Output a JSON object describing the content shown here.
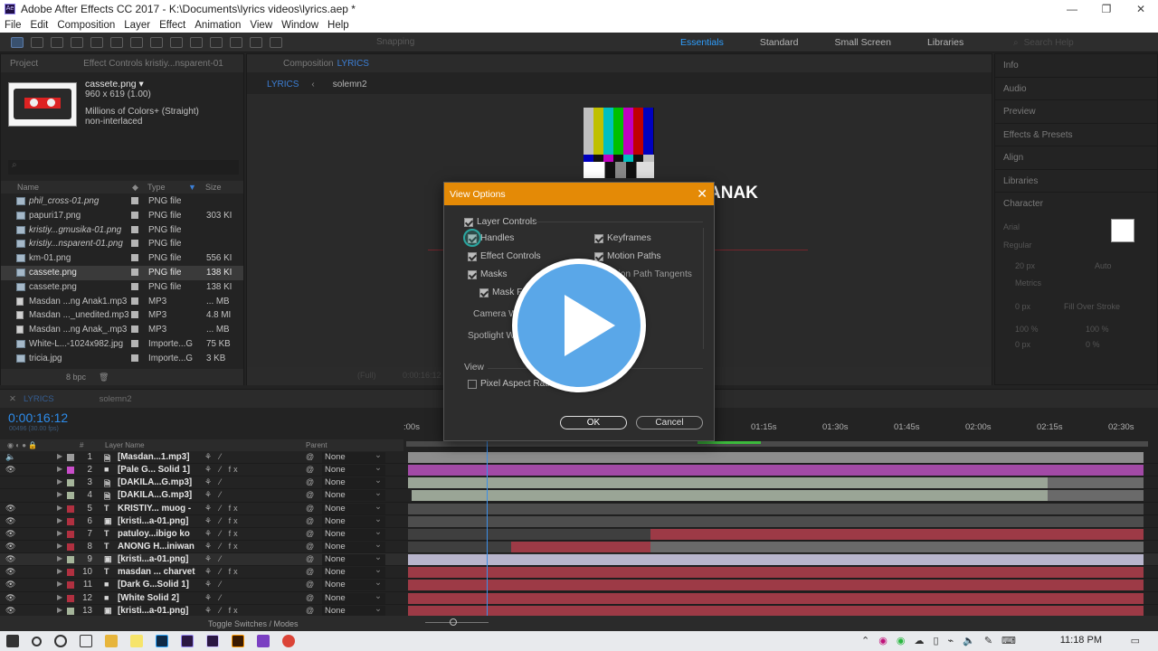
{
  "window": {
    "title": "Adobe After Effects CC 2017 - K:\\Documents\\lyrics videos\\lyrics.aep *",
    "minimize": "—",
    "maximize": "❐",
    "close": "✕"
  },
  "menu": [
    "File",
    "Edit",
    "Composition",
    "Layer",
    "Effect",
    "Animation",
    "View",
    "Window",
    "Help"
  ],
  "toolbar": {
    "snapping": "Snapping",
    "workspaces": [
      "Essentials",
      "Standard",
      "Small Screen",
      "Libraries"
    ],
    "active_workspace": "Essentials",
    "search_placeholder": "Search Help"
  },
  "project": {
    "tab_project": "Project",
    "tab_effect_controls": "Effect Controls kristiy...nsparent-01",
    "selected_file": {
      "name": "cassete.png",
      "dimensions": "960 x 619 (1.00)",
      "colors": "Millions of Colors+ (Straight)",
      "interlace": "non-interlaced"
    },
    "search_placeholder": "⌕",
    "columns": {
      "name": "Name",
      "type": "Type",
      "size": "Size"
    },
    "files": [
      {
        "name": "phil_cross-01.png",
        "type": "PNG file",
        "size": "",
        "italic": true,
        "kind": "image"
      },
      {
        "name": "papuri17.png",
        "type": "PNG file",
        "size": "303 KI",
        "italic": false,
        "kind": "image"
      },
      {
        "name": "kristiy...gmusika-01.png",
        "type": "PNG file",
        "size": "",
        "italic": true,
        "kind": "image"
      },
      {
        "name": "kristiy...nsparent-01.png",
        "type": "PNG file",
        "size": "",
        "italic": true,
        "kind": "image"
      },
      {
        "name": "km-01.png",
        "type": "PNG file",
        "size": "556 KI",
        "italic": false,
        "kind": "image"
      },
      {
        "name": "cassete.png",
        "type": "PNG file",
        "size": "138 KI",
        "italic": false,
        "kind": "image",
        "selected": true
      },
      {
        "name": "cassete.png",
        "type": "PNG file",
        "size": "138 KI",
        "italic": false,
        "kind": "image"
      },
      {
        "name": "Masdan ...ng Anak1.mp3",
        "type": "MP3",
        "size": "... MB",
        "italic": false,
        "kind": "audio"
      },
      {
        "name": "Masdan ..._unedited.mp3",
        "type": "MP3",
        "size": "4.8 MI",
        "italic": false,
        "kind": "audio"
      },
      {
        "name": "Masdan ...ng Anak_.mp3",
        "type": "MP3",
        "size": "... MB",
        "italic": false,
        "kind": "audio"
      },
      {
        "name": "White-L...-1024x982.jpg",
        "type": "Importe...G",
        "size": "75 KB",
        "italic": false,
        "kind": "image"
      },
      {
        "name": "tricia.jpg",
        "type": "Importe...G",
        "size": "3 KB",
        "italic": false,
        "kind": "image"
      }
    ],
    "bpc": "8 bpc"
  },
  "composition": {
    "tab": "Composition",
    "tab_name": "LYRICS",
    "breadcrumbs": [
      "LYRICS",
      "solemn2"
    ],
    "visible_text": "ANAK",
    "footer_zoom": "(Full)",
    "footer_time": "0:00:16:12"
  },
  "right_panels": [
    "Info",
    "Audio",
    "Preview",
    "Effects & Presets",
    "Align",
    "Libraries",
    "Character"
  ],
  "character": {
    "font": "Arial",
    "style": "Regular",
    "size": "20 px",
    "leading": "Auto",
    "tracking": "Metrics",
    "stroke": "0 px",
    "stroke_mode": "Fill Over Stroke",
    "scale_v": "100 %",
    "scale_h": "100 %",
    "baseline": "0 px",
    "tsume": "0 %"
  },
  "timeline": {
    "tabs": [
      "LYRICS",
      "solemn2"
    ],
    "timecode": "0:00:16:12",
    "fps": "00496 (30.00 fps)",
    "ruler_ticks": [
      ":00s",
      "01:15s",
      "01:30s",
      "01:45s",
      "02:00s",
      "02:15s",
      "02:30s"
    ],
    "column_headers": {
      "layer_name": "Layer Name",
      "parent": "Parent"
    },
    "footer_label": "Toggle Switches / Modes",
    "layers": [
      {
        "num": "1",
        "type": "audio",
        "name": "[Masdan...1.mp3]",
        "label_color": "#9c9c9c",
        "parent": "None",
        "bar_color": "#8d8d8d",
        "bar_start": 0,
        "bar_end": 1,
        "eye": false,
        "fx": false
      },
      {
        "num": "2",
        "type": "solid",
        "name": "[Pale G... Solid 1]",
        "label_color": "#c94dc9",
        "parent": "None",
        "bar_color": "#a24aa6",
        "bar_start": 0,
        "bar_end": 1,
        "eye": true,
        "fx": true
      },
      {
        "num": "3",
        "type": "audio",
        "name": "[DAKILA...G.mp3]",
        "label_color": "#a5b59a",
        "parent": "None",
        "bar_color": "#9aa596",
        "bar_start": 0,
        "bar_end": 0.87,
        "eye": false,
        "fx": false
      },
      {
        "num": "4",
        "type": "audio",
        "name": "[DAKILA...G.mp3]",
        "label_color": "#a5b59a",
        "parent": "None",
        "bar_color": "#9aa596",
        "bar_start": 0.005,
        "bar_end": 0.87,
        "eye": false,
        "fx": false
      },
      {
        "num": "5",
        "type": "text",
        "name": "KRISTIY... muog -",
        "label_color": "#b03040",
        "parent": "None",
        "bar_color": "#4d4d4d",
        "bar_start": 0,
        "bar_end": 1,
        "eye": true,
        "fx": true
      },
      {
        "num": "6",
        "type": "image",
        "name": "[kristi...a-01.png]",
        "label_color": "#b03040",
        "parent": "None",
        "bar_color": "#4d4d4d",
        "bar_start": 0,
        "bar_end": 1,
        "eye": true,
        "fx": true
      },
      {
        "num": "7",
        "type": "text",
        "name": "patuloy...ibigo ko",
        "label_color": "#b03040",
        "parent": "None",
        "bar_color": "#9d3a46",
        "bar_start": 0.33,
        "bar_end": 1,
        "eye": true,
        "fx": true
      },
      {
        "num": "8",
        "type": "text",
        "name": "ANONG H...iniwan",
        "label_color": "#b03040",
        "parent": "None",
        "bar_color": "#9d3a46",
        "bar_start": 0.14,
        "bar_end": 0.33,
        "eye": true,
        "fx": true
      },
      {
        "num": "9",
        "type": "image",
        "name": "[kristi...a-01.png]",
        "label_color": "#a5b59a",
        "parent": "None",
        "bar_color": "#b8b5cc",
        "bar_start": 0,
        "bar_end": 1,
        "eye": true,
        "fx": false,
        "selected": true
      },
      {
        "num": "10",
        "type": "text",
        "name": "masdan ... charvet",
        "label_color": "#b03040",
        "parent": "None",
        "bar_color": "#9d3a46",
        "bar_start": 0,
        "bar_end": 1,
        "eye": true,
        "fx": true
      },
      {
        "num": "11",
        "type": "solid",
        "name": "[Dark G...Solid 1]",
        "label_color": "#b03040",
        "parent": "None",
        "bar_color": "#9d3a46",
        "bar_start": 0,
        "bar_end": 1,
        "eye": true,
        "fx": false
      },
      {
        "num": "12",
        "type": "solid",
        "name": "[White Solid 2]",
        "label_color": "#b03040",
        "parent": "None",
        "bar_color": "#9d3a46",
        "bar_start": 0,
        "bar_end": 1,
        "eye": true,
        "fx": false
      },
      {
        "num": "13",
        "type": "image",
        "name": "[kristi...a-01.png]",
        "label_color": "#a5b59a",
        "parent": "None",
        "bar_color": "#9d3a46",
        "bar_start": 0,
        "bar_end": 1,
        "eye": true,
        "fx": true
      }
    ]
  },
  "dialog": {
    "title": "View Options",
    "close": "✕",
    "layer_controls": "Layer Controls",
    "handles": "Handles",
    "effect_controls": "Effect Controls",
    "masks": "Masks",
    "mask_feather": "Mask Fe...",
    "camera_wireframes": "Camera Wi...",
    "spotlight_wireframes": "Spotlight Wi...",
    "keyframes": "Keyframes",
    "motion_paths": "Motion Paths",
    "motion_path_tangents": "...ion Path Tangents",
    "view_section": "View",
    "pixel_aspect": "Pixel Aspect Ratio...",
    "ok": "OK",
    "cancel": "Cancel"
  },
  "taskbar": {
    "time": "11:18 PM",
    "apps": [
      "start-icon",
      "search-icon",
      "cortana-icon",
      "taskview-icon",
      "explorer-icon",
      "sticky-icon",
      "photoshop-icon",
      "premiere-icon",
      "aftereffects-icon",
      "illustrator-icon",
      "visualstudio-icon",
      "chrome-icon"
    ]
  }
}
